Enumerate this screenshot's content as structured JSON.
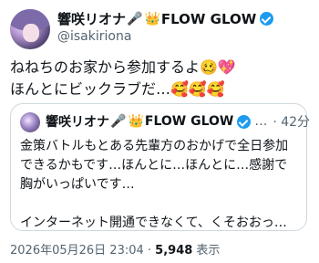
{
  "author": {
    "display_name_text": "響咲リオナ",
    "display_name_emoji1": "🎤",
    "display_name_emoji2": "👑",
    "display_name_suffix": "FLOW GLOW",
    "handle": "@isakiriona"
  },
  "tweet": {
    "text": "ねねちのお家から参加するよ🥴💖\nほんとにビックラブだ…🥰🥰🥰"
  },
  "quote": {
    "display_name_text": "響咲リオナ",
    "display_name_emoji1": "🎤",
    "display_name_emoji2": "👑",
    "display_name_suffix": "FLOW GLOW",
    "ellipsis": "…",
    "time": "· 42分",
    "text": "金策バトルもとある先輩方のおかげで全日参加できるかもです…ほんとに…ほんとに…感謝で胸がいっぱいです…\n\nインターネット開通できなくて、くそおおっ…"
  },
  "footer": {
    "timestamp": "2026年05月26日 23:04",
    "separator": " · ",
    "views_count": "5,948",
    "views_label": " 表示"
  },
  "colors": {
    "verified": "#1d9bf0",
    "secondary_text": "#536471",
    "border": "#cfd9de"
  }
}
